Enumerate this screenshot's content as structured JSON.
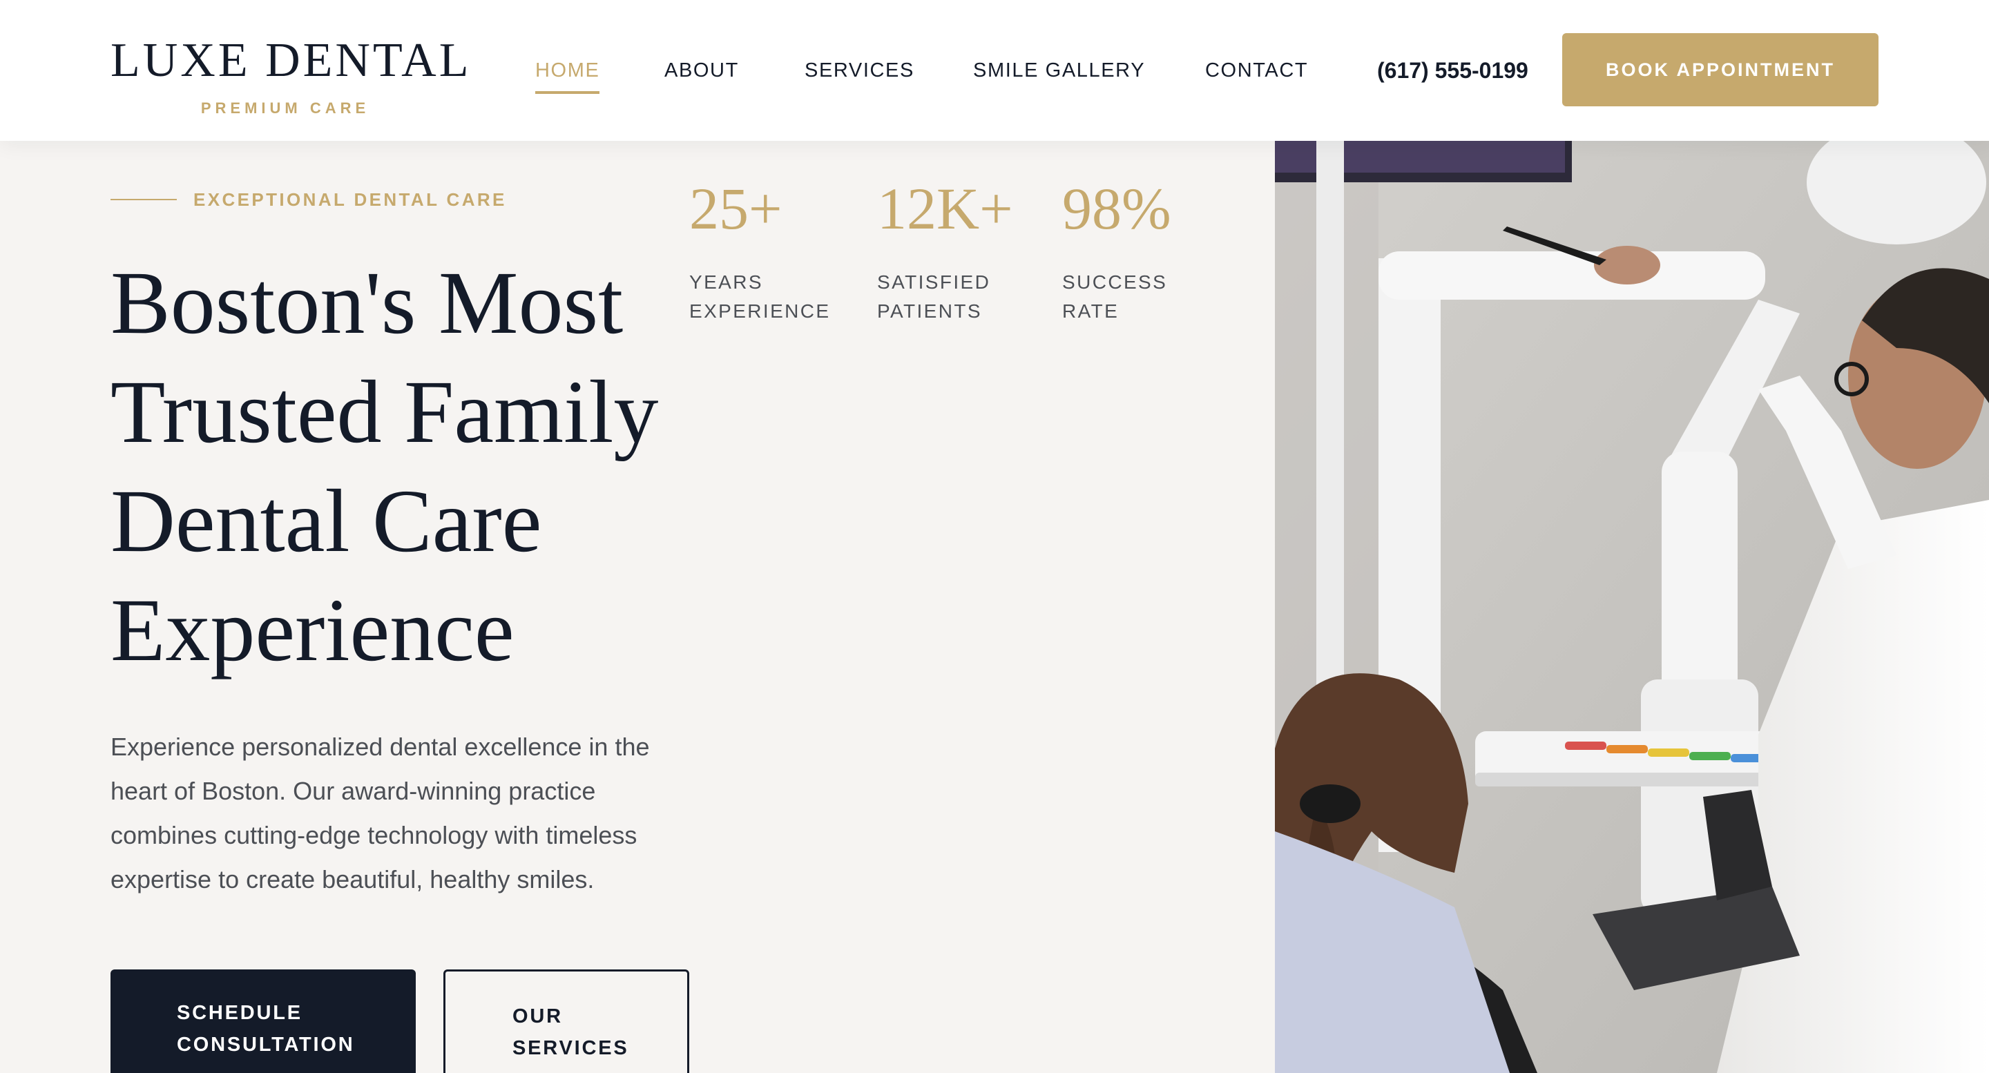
{
  "brand": {
    "name": "LUXE DENTAL",
    "tagline": "PREMIUM CARE"
  },
  "nav": {
    "items": [
      "HOME",
      "ABOUT",
      "SERVICES",
      "SMILE GALLERY",
      "CONTACT"
    ],
    "active": "HOME"
  },
  "header": {
    "phone": "(617) 555-0199",
    "cta": "BOOK APPOINTMENT"
  },
  "hero": {
    "eyebrow": "EXCEPTIONAL DENTAL CARE",
    "title_lines": [
      "Boston's Most",
      "Trusted Family",
      "Dental Care",
      "Experience"
    ],
    "description": "Experience personalized dental excellence in the heart of Boston. Our award-winning practice combines cutting-edge technology with timeless expertise to create beautiful, healthy smiles.",
    "primary_cta_lines": [
      "SCHEDULE",
      "CONSULTATION"
    ],
    "secondary_cta_lines": [
      "OUR",
      "SERVICES"
    ]
  },
  "stats": [
    {
      "value": "25+",
      "label_lines": [
        "YEARS",
        "EXPERIENCE"
      ]
    },
    {
      "value": "12K+",
      "label_lines": [
        "SATISFIED",
        "PATIENTS"
      ]
    },
    {
      "value": "98%",
      "label_lines": [
        "SUCCESS",
        "RATE"
      ]
    }
  ],
  "colors": {
    "accent_gold": "#c6a96d",
    "navy": "#141b29",
    "page_background": "#f6f4f2",
    "body_text": "#4c4f55"
  }
}
